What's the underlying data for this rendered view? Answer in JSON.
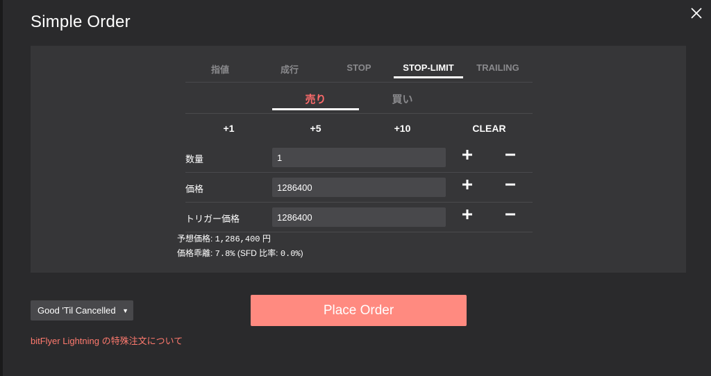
{
  "title": "Simple Order",
  "tabs": [
    {
      "label": "指値"
    },
    {
      "label": "成行"
    },
    {
      "label": "STOP"
    },
    {
      "label": "STOP-LIMIT"
    },
    {
      "label": "TRAILING"
    }
  ],
  "active_tab": "STOP-LIMIT",
  "sides": {
    "sell": "売り",
    "buy": "買い",
    "active": "売り"
  },
  "increments": [
    "+1",
    "+5",
    "+10",
    "CLEAR"
  ],
  "fields": [
    {
      "label": "数量",
      "value": "1"
    },
    {
      "label": "価格",
      "value": "1286400"
    },
    {
      "label": "トリガー価格",
      "value": "1286400"
    }
  ],
  "estimate": {
    "price_label": "予想価格: ",
    "price_value": "1,286,400",
    "price_unit": " 円",
    "deviation_label": "価格乖離: ",
    "deviation_value": "7.8%",
    "sfd_prefix": " (SFD 比率: ",
    "sfd_value": "0.0%",
    "sfd_suffix": ")"
  },
  "time_in_force": {
    "selected": "Good 'Til Cancelled"
  },
  "place_order_label": "Place Order",
  "help_link": "bitFlyer Lightning の特殊注文について",
  "colors": {
    "background": "#2a2a2c",
    "panel": "#363638",
    "input": "#48484b",
    "sell": "#ff6b6b",
    "button": "#ff8a80",
    "link": "#ff7a6e"
  },
  "icons": {
    "close": "close-icon",
    "plus": "plus-icon",
    "minus": "minus-icon",
    "dropdown": "caret-down-icon"
  }
}
